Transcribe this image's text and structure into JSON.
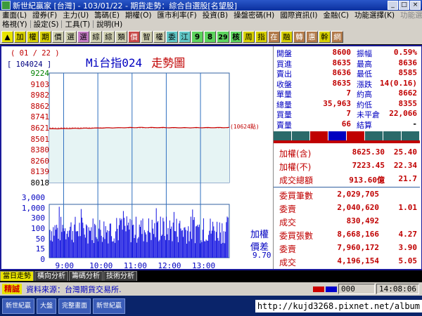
{
  "window": {
    "title": "新世紀贏家 [台灣] - 103/01/22 - 期貨走勢：綜合自選股[名望股]",
    "buttons": [
      "_",
      "□",
      "×"
    ]
  },
  "menu1": [
    "畫面(L)",
    "證券(F)",
    "主力(U)",
    "籌碼(E)",
    "期權(O)",
    "匯市利率(F)",
    "投資(B)",
    "操盤密碼(H)",
    "國際資訊(I)",
    "金融(C)",
    "功能選擇(K)",
    "功能選擇(V)"
  ],
  "menu2": [
    "格視(Y)",
    "設定(S)",
    "工具(T)",
    "說明(H)"
  ],
  "toolbar": {
    "items": [
      "▲",
      "加",
      "權",
      "期",
      "價",
      "選",
      "選",
      "綜",
      "綜",
      "類",
      "價",
      "智",
      "權",
      "委",
      "江",
      "9",
      "8",
      "29",
      "核",
      "周",
      "指",
      "在",
      "融",
      "轉",
      "惠",
      "幹",
      "網"
    ]
  },
  "chart": {
    "date": "( 01 / 22 )",
    "code": "[ 104024 ]",
    "title_code": "Mi台指024",
    "title_suffix": "走勢圖",
    "price_ticks": [
      "9224",
      "9103",
      "8982",
      "8862",
      "8741",
      "8621",
      "8501",
      "8380",
      "8260",
      "8139",
      "8018"
    ],
    "volume_ticks": [
      "3,000",
      "1,000",
      "300",
      "100",
      "50",
      "15",
      "0"
    ],
    "time_ticks": [
      "9:00",
      "10:00",
      "11:00",
      "12:00",
      "13:00"
    ],
    "side_label": "(10624點)",
    "basis_label": "加權",
    "basis_label2": "價差",
    "basis_value": "9.70"
  },
  "chart_data": {
    "type": "line",
    "title": "Mi台指024 走勢圖",
    "ylim": [
      8018,
      9224
    ],
    "x": [
      "9:00",
      "10:00",
      "11:00",
      "12:00",
      "13:00"
    ],
    "series": [
      {
        "values": [
          8610,
          8618,
          8625,
          8622,
          8624
        ]
      }
    ],
    "volume_ylim_labels": [
      "3,000",
      "1,000",
      "300",
      "100",
      "50",
      "15",
      "0"
    ]
  },
  "quote": {
    "rows": [
      [
        "開盤",
        "8600",
        "振幅",
        "0.59%"
      ],
      [
        "買進",
        "8635",
        "最高",
        "8636"
      ],
      [
        "賣出",
        "8636",
        "最低",
        "8585"
      ],
      [
        "收盤",
        "8635",
        "漲跌",
        "14(0.16)"
      ],
      [
        "單量",
        "7",
        "約高",
        "8662"
      ],
      [
        "總量",
        "35,963",
        "約低",
        "8355"
      ],
      [
        "買量",
        "7",
        "未平倉",
        "22,066"
      ],
      [
        "賣量",
        "66",
        "結算",
        "-"
      ]
    ]
  },
  "index": {
    "rows": [
      [
        "加權(含)",
        "8625.30",
        "25.40"
      ],
      [
        "加權(不)",
        "7223.45",
        "22.34"
      ],
      [
        "成交總額",
        "913.60億",
        "21.7"
      ]
    ]
  },
  "orders": {
    "rows": [
      [
        "委買筆數",
        "2,029,705",
        ""
      ],
      [
        "委賣",
        "2,040,620",
        "1.01"
      ],
      [
        "成交",
        "830,492",
        ""
      ],
      [
        "委買張數",
        "8,668,166",
        "4.27"
      ],
      [
        "委賣",
        "7,960,172",
        "3.90"
      ],
      [
        "成交",
        "4,196,154",
        "5.05"
      ]
    ]
  },
  "tabs": [
    "當日走勢",
    "橫向分析",
    "籌碼分析",
    "技術分析"
  ],
  "status": {
    "badge": "精誠",
    "source": "資料來源：台灣期貨交易所.",
    "code": "000",
    "time": "14:08:06"
  },
  "taskbar": {
    "items": [
      "新世紀贏",
      "大盤",
      "完整畫面",
      "新世紀贏"
    ],
    "url": "http://kujd3268.pixnet.net/album"
  },
  "colors": {
    "price_line": "#cc0000",
    "volume": "#1010e0",
    "grid": "#3070c0",
    "accent": "#e8e400"
  }
}
